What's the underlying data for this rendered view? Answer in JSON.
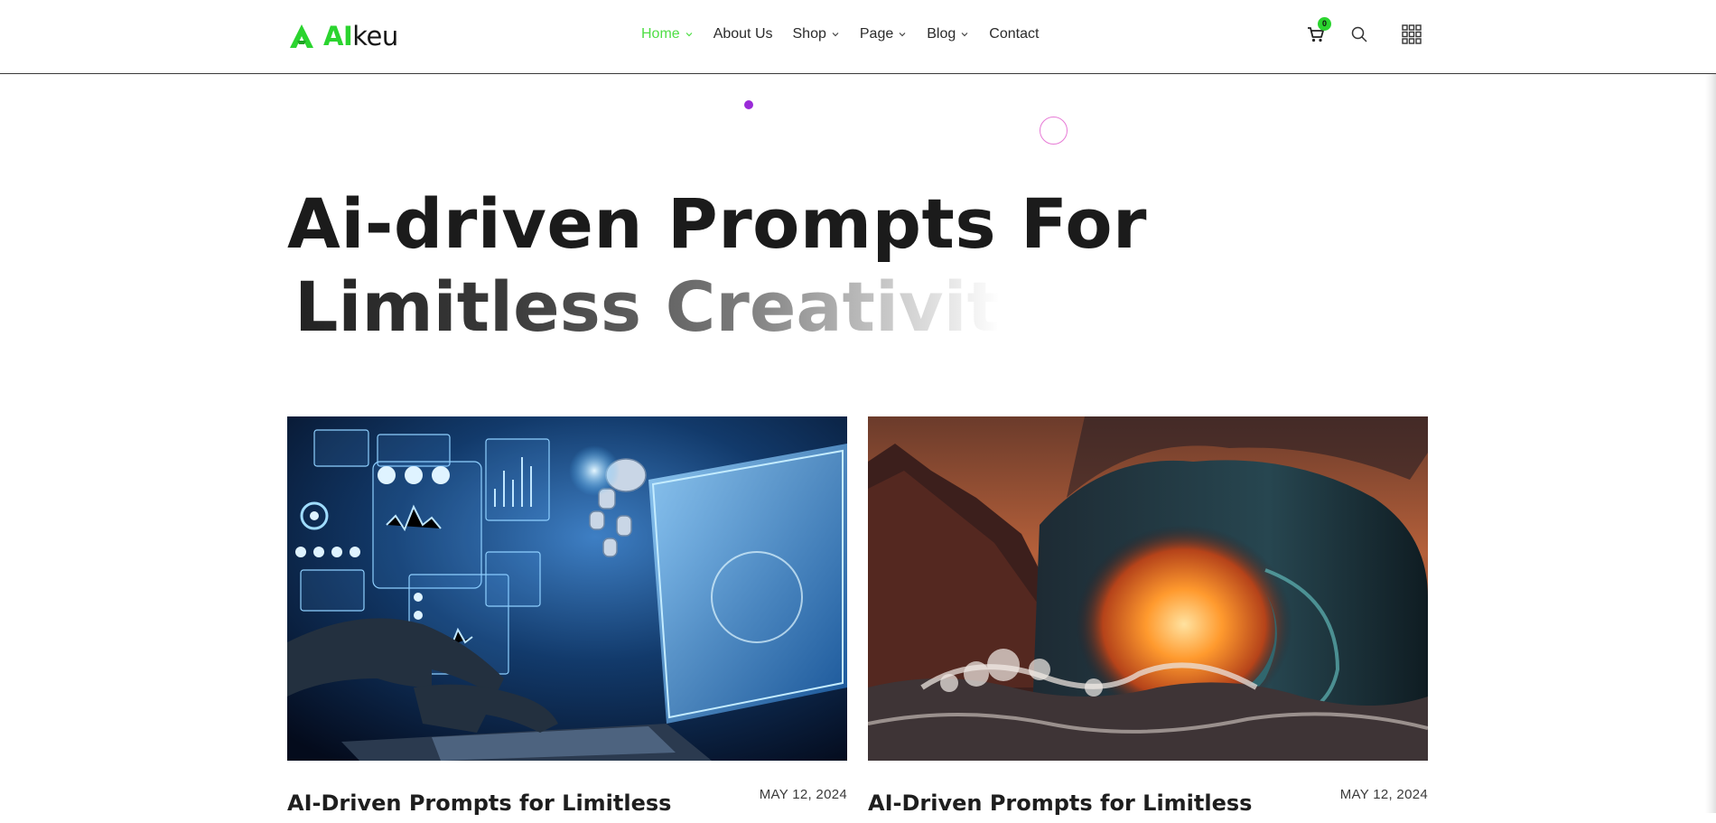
{
  "header": {
    "logo": {
      "accent": "AI",
      "rest": "keu",
      "icon": "logo-a-icon"
    },
    "nav": [
      {
        "label": "Home",
        "active": true,
        "has_dropdown": true
      },
      {
        "label": "About Us",
        "active": false,
        "has_dropdown": false
      },
      {
        "label": "Shop",
        "active": false,
        "has_dropdown": true
      },
      {
        "label": "Page",
        "active": false,
        "has_dropdown": true
      },
      {
        "label": "Blog",
        "active": false,
        "has_dropdown": true
      },
      {
        "label": "Contact",
        "active": false,
        "has_dropdown": false
      }
    ],
    "cart": {
      "icon": "cart-icon",
      "count": "0"
    },
    "search": {
      "icon": "search-icon"
    },
    "menu": {
      "icon": "grid-menu-icon"
    }
  },
  "hero": {
    "line1": "Ai-driven Prompts For",
    "line2": "Limitless Creativit"
  },
  "cards": [
    {
      "title": "AI-Driven Prompts for Limitless",
      "date": "MAY 12, 2024",
      "image": "ai-robot-laptop-image"
    },
    {
      "title": "AI-Driven Prompts for Limitless",
      "date": "MAY 12, 2024",
      "image": "ocean-wave-sunset-image"
    }
  ],
  "colors": {
    "accent_green": "#2bd42f",
    "nav_active": "#4fde45",
    "dot_purple": "#9a2ad8",
    "ring_pink": "#e77ad6",
    "text_dark": "#1b1b1b"
  }
}
